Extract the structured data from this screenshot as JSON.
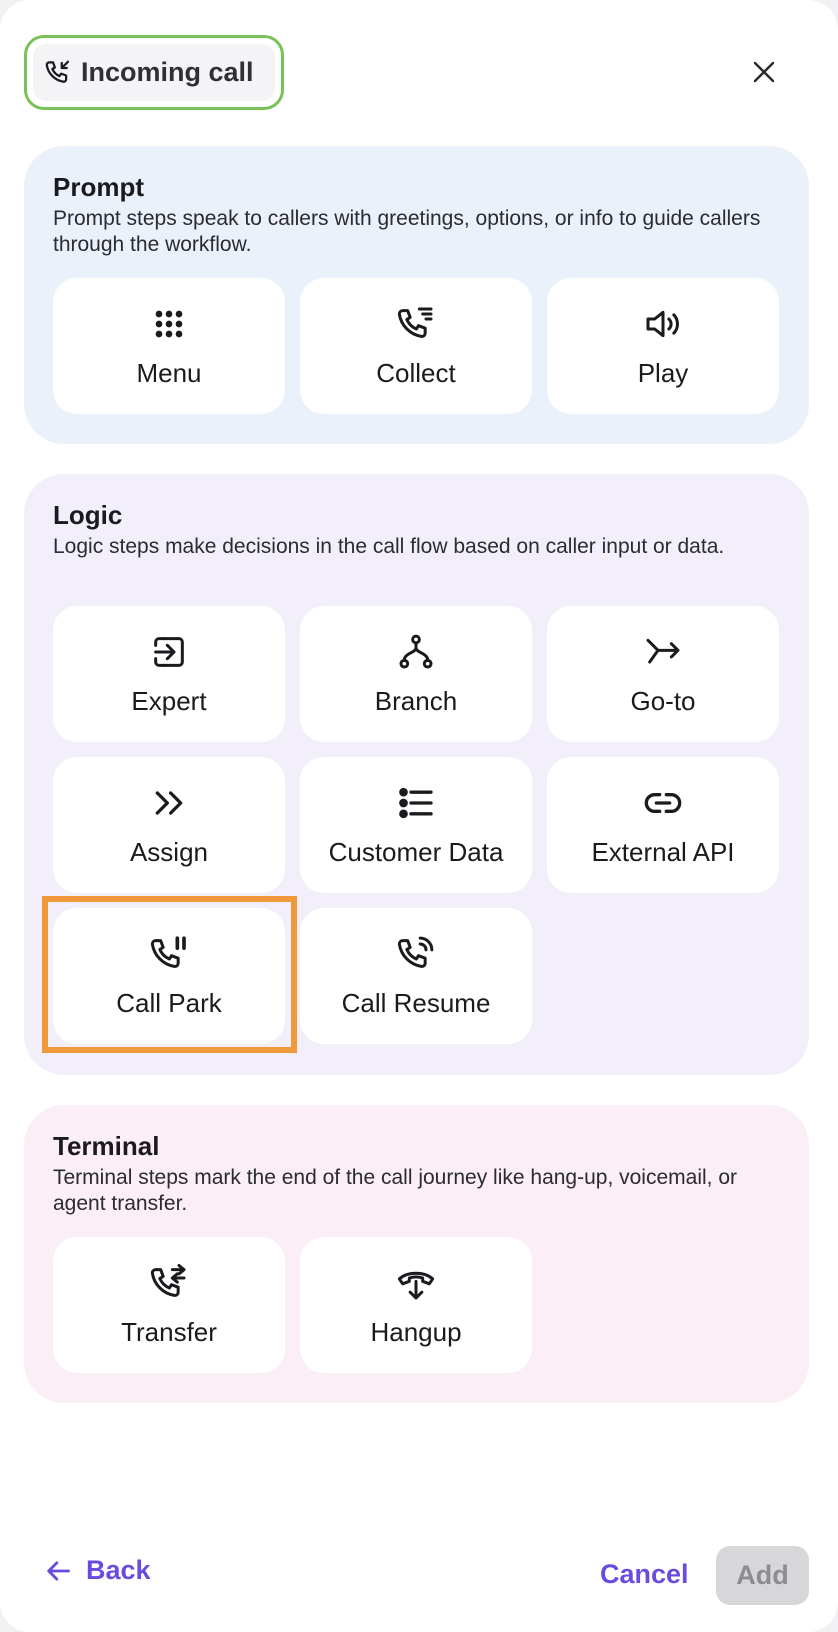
{
  "header": {
    "trigger_label": "Incoming call",
    "trigger_icon": "incoming-call-icon",
    "close_icon": "close-icon"
  },
  "sections": {
    "prompt": {
      "title": "Prompt",
      "description": "Prompt steps speak to callers with greetings, options, or info to guide callers through the workflow.",
      "items": [
        {
          "label": "Menu",
          "icon": "grid-dots-icon"
        },
        {
          "label": "Collect",
          "icon": "phone-list-icon"
        },
        {
          "label": "Play",
          "icon": "speaker-icon"
        }
      ]
    },
    "logic": {
      "title": "Logic",
      "description": "Logic steps make decisions in the call flow based on caller input or data.",
      "items": [
        {
          "label": "Expert",
          "icon": "enter-box-icon"
        },
        {
          "label": "Branch",
          "icon": "branch-icon"
        },
        {
          "label": "Go-to",
          "icon": "redirect-arrow-icon"
        },
        {
          "label": "Assign",
          "icon": "double-chevron-icon"
        },
        {
          "label": "Customer Data",
          "icon": "list-icon"
        },
        {
          "label": "External API",
          "icon": "link-icon"
        },
        {
          "label": "Call Park",
          "icon": "phone-pause-icon",
          "selected": true
        },
        {
          "label": "Call Resume",
          "icon": "phone-signal-icon"
        }
      ]
    },
    "terminal": {
      "title": "Terminal",
      "description": "Terminal steps mark the end of the call journey like hang-up, voicemail, or agent transfer.",
      "items": [
        {
          "label": "Transfer",
          "icon": "phone-transfer-icon"
        },
        {
          "label": "Hangup",
          "icon": "hangup-icon"
        }
      ]
    }
  },
  "footer": {
    "back_label": "Back",
    "cancel_label": "Cancel",
    "add_label": "Add"
  },
  "colors": {
    "accent": "#6a4be0",
    "selection_outline": "#f0993b",
    "trigger_outline": "#78c257",
    "prompt_bg": "#eaf1fa",
    "logic_bg": "#f2effb",
    "terminal_bg": "#fbeef6"
  }
}
